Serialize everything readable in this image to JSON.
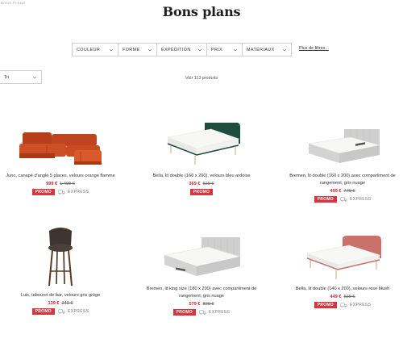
{
  "breadcrumb": "BONS PLANS",
  "page_title": "Bons plans",
  "filters": [
    {
      "label": "COULEUR"
    },
    {
      "label": "FORME"
    },
    {
      "label": "EXPÉDITION"
    },
    {
      "label": "PRIX"
    },
    {
      "label": "MATÉRIAUX"
    }
  ],
  "more_filters": "Plus de filtres...",
  "sort": {
    "value": "Tri"
  },
  "product_count": "Voir 113 produits",
  "colors": {
    "promo": "#d8353f",
    "price": "#d0202e",
    "sofa": "#c4471f",
    "headboard_green": "#1f4d40",
    "headboard_pink": "#c9716a",
    "stool": "#3f3530",
    "grey_bed": "#cfcfcf"
  },
  "products": [
    {
      "name": "Juno, canapé d'angle 5 places, velours orange flamme",
      "price": "999 €",
      "old_price": "1 499 €",
      "promo": "PROMO",
      "express": "EXPRESS",
      "image": "corner-sofa-orange"
    },
    {
      "name": "Bella, lit double (160 x 200), velours bleu ardoise",
      "price": "369 €",
      "old_price": "529 €",
      "promo": "PROMO",
      "express": "",
      "image": "bed-green-velvet"
    },
    {
      "name": "Bremen, lit double (160 x 200) avec compartiment de rangement, gris nuage",
      "price": "499 €",
      "old_price": "779 €",
      "promo": "PROMO",
      "express": "EXPRESS",
      "image": "bed-grey-storage"
    },
    {
      "name": "Luis, tabouret de bar, velours gris grège",
      "price": "139 €",
      "old_price": "249 €",
      "promo": "PROMO",
      "express": "EXPRESS",
      "image": "bar-stool"
    },
    {
      "name": "Bremen, lit king size (180 x 200) avec compartiment de rangement, gris nuage",
      "price": "579 €",
      "old_price": "829 €",
      "promo": "PROMO",
      "express": "EXPRESS",
      "image": "bed-grey-kingsize"
    },
    {
      "name": "Bella, lit double (140 x 200), velours rose blush",
      "price": "449 €",
      "old_price": "629 €",
      "promo": "PROMO",
      "express": "EXPRESS",
      "image": "bed-pink-velvet"
    }
  ]
}
